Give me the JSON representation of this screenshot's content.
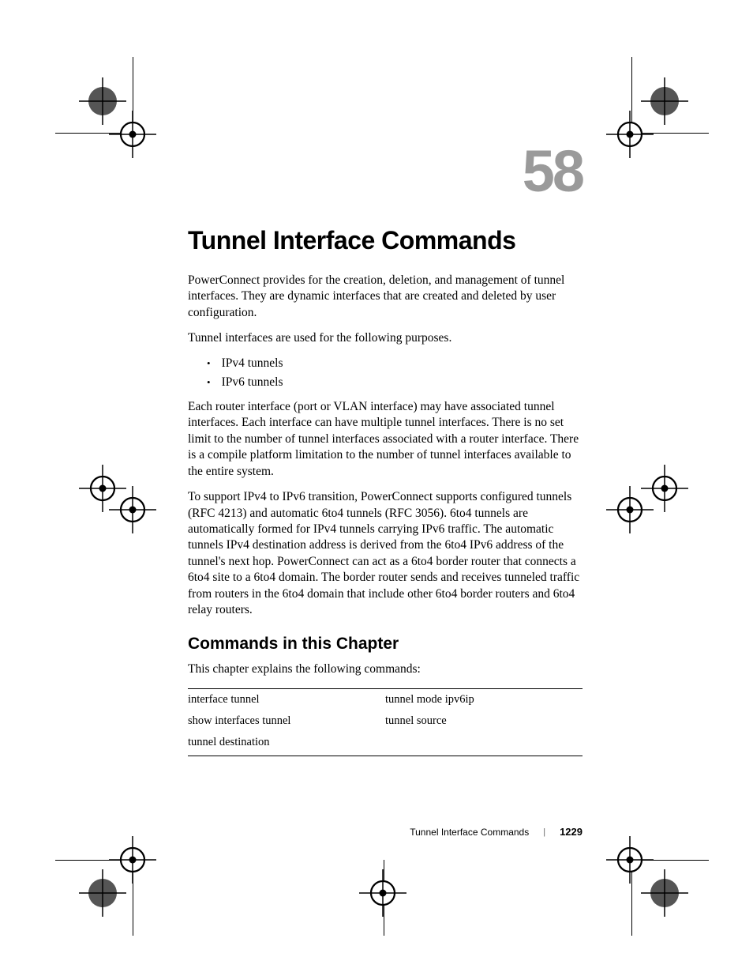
{
  "chapter_number": "58",
  "chapter_title": "Tunnel Interface Commands",
  "intro_p1": "PowerConnect provides for the creation, deletion, and management of tunnel interfaces. They are dynamic interfaces that are created and deleted by user configuration.",
  "intro_p2": "Tunnel interfaces are used for the following purposes.",
  "bullets": {
    "b0": "IPv4 tunnels",
    "b1": "IPv6 tunnels"
  },
  "para_router": "Each router interface (port or VLAN interface) may have associated tunnel interfaces. Each interface can have multiple tunnel interfaces. There is no set limit to the number of tunnel interfaces associated with a router interface. There is a compile platform limitation to the number of tunnel interfaces available to the entire system.",
  "para_transition": "To support IPv4 to IPv6 transition, PowerConnect supports configured tunnels (RFC 4213) and automatic 6to4 tunnels (RFC 3056). 6to4 tunnels are automatically formed for IPv4 tunnels carrying IPv6 traffic. The automatic tunnels IPv4 destination address is derived from the 6to4 IPv6 address of the tunnel's next hop. PowerConnect can act as a 6to4 border router that connects a 6to4 site to a 6to4 domain. The border router sends and receives tunneled traffic from routers in the 6to4 domain that include other 6to4 border routers and 6to4 relay routers.",
  "section_heading": "Commands in this Chapter",
  "section_intro": "This chapter explains the following commands:",
  "commands": {
    "r0c0": "interface tunnel",
    "r0c1": "tunnel mode ipv6ip",
    "r1c0": "show interfaces tunnel",
    "r1c1": "tunnel source",
    "r2c0": "tunnel destination",
    "r2c1": ""
  },
  "footer": {
    "title": "Tunnel Interface Commands",
    "separator": "|",
    "page": "1229"
  }
}
